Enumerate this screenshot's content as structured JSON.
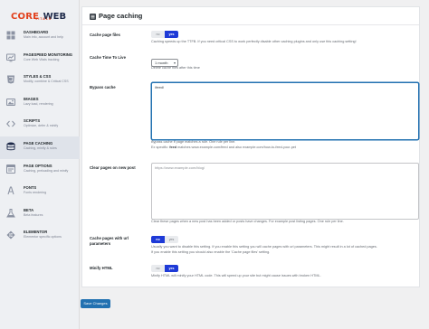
{
  "app": {
    "logo_word1": "CORE",
    "logo_word2": "WEB",
    "logo_sub": "VITALS"
  },
  "sidebar": {
    "items": [
      {
        "title": "Dashboard",
        "subtitle": "Main info, account and help",
        "icon": "dashboard-icon"
      },
      {
        "title": "Pagespeed Monitoring",
        "subtitle": "Core Web Vitals tracking",
        "icon": "speed-monitor-icon"
      },
      {
        "title": "Styles & CSS",
        "subtitle": "Modify, combine & Critical CSS",
        "icon": "css-icon"
      },
      {
        "title": "Images",
        "subtitle": "Lazy load, rendering",
        "icon": "image-icon"
      },
      {
        "title": "Scripts",
        "subtitle": "Optimize, defer & minify",
        "icon": "code-icon"
      },
      {
        "title": "Page Caching",
        "subtitle": "Caching, minify & rules",
        "icon": "cache-icon"
      },
      {
        "title": "Page Options",
        "subtitle": "Caching, preloading and minify",
        "icon": "page-options-icon"
      },
      {
        "title": "Fonts",
        "subtitle": "Fonts rendering",
        "icon": "font-icon"
      },
      {
        "title": "Beta",
        "subtitle": "Beta features",
        "icon": "beta-icon"
      },
      {
        "title": "Elementor",
        "subtitle": "Elementor specific options",
        "icon": "elementor-icon"
      }
    ],
    "active_index": 5
  },
  "main": {
    "title": "Page caching",
    "page_files": {
      "label": "Cache page files",
      "off": "no",
      "on": "yes",
      "value": "yes",
      "description": "Caching speeds up the TTFB. If you need critical CSS to work perfectly disable other caching plugins and only use this caching setting!"
    },
    "cache_time": {
      "label": "Cache Time To Live",
      "value": "1 month",
      "description": "Delete cache files after this time"
    },
    "bypass": {
      "label": "Bypass cache",
      "value": "/feed/",
      "help1": "Bypass cache if page matches a rule. One rule per line.",
      "help2_prefix": "Ex specific: ",
      "help2_bold": "feed",
      "help2_suffix": " matches www.example.com/feed and also example.com/how-to-feed-your-pet"
    },
    "clear_on_post": {
      "label": "Clear pages on new post",
      "placeholder": "https://www.example.com/blog/",
      "help": "Clear these pages when a new post has been added or posts have changes. For example post listing pages. One rule per line."
    },
    "url_params": {
      "label_line1": "Cache pages with url",
      "label_line2": "parameters",
      "off": "no",
      "on": "yes",
      "value": "no",
      "description_line1": "Usually you want to disable this setting. If you enable this setting you will cache pages with url parameters. This might result in a lot of cached pages.",
      "description_line2": "If you enable this setting you should also enable the 'Cache page files' setting."
    },
    "minify": {
      "label": "Minify HTML",
      "off": "no",
      "on": "yes",
      "value": "yes",
      "description": "Minify HTML will minify your HTML code. This will speed up your site but might cause issues with broken HTML."
    }
  },
  "actions": {
    "save_label": "Save Changes"
  },
  "colors": {
    "accent": "#1e3ad7",
    "save": "#2271b1",
    "logo_red": "#e2401c",
    "logo_navy": "#1e2a4a"
  }
}
